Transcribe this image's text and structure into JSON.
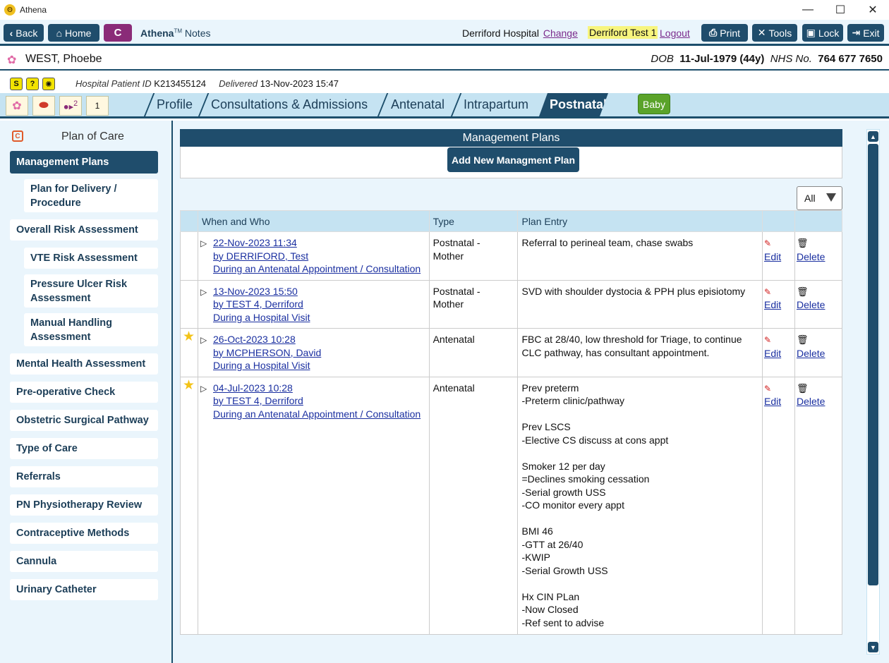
{
  "window": {
    "title": "Athena",
    "minimize": "—",
    "maximize": "☐",
    "close": "✕"
  },
  "toolbar": {
    "back_label": "Back",
    "home_label": "Home",
    "c_label": "C",
    "brand_name": "Athena",
    "brand_tm": "TM",
    "brand_suffix": " Notes",
    "hospital": "Derriford Hospital",
    "change_label": "Change",
    "user": "Derriford Test 1",
    "logout_label": "Logout",
    "print_label": "Print",
    "tools_label": "Tools",
    "lock_label": "Lock",
    "exit_label": "Exit"
  },
  "patient": {
    "name": "WEST, Phoebe",
    "dob_label": "DOB",
    "dob": "11-Jul-1979 (44y)",
    "nhs_label": "NHS No.",
    "nhs": "764 677 7650",
    "hospital_id_label": "Hospital Patient ID",
    "hospital_id": "K213455124",
    "delivered_label": "Delivered",
    "delivered": "13-Nov-2023 15:47"
  },
  "tab_icons": {
    "counter": "2",
    "note": "1"
  },
  "tabs": [
    "Profile",
    "Consultations & Admissions",
    "Antenatal",
    "Intrapartum",
    "Postnatal"
  ],
  "baby_label": "Baby",
  "sidebar": {
    "title": "Plan of Care",
    "items": [
      "Management Plans",
      "Plan for Delivery / Procedure",
      "Overall Risk Assessment",
      "VTE Risk Assessment",
      "Pressure Ulcer Risk Assessment",
      "Manual Handling Assessment",
      "Mental Health Assessment",
      "Pre-operative Check",
      "Obstetric Surgical Pathway",
      "Type of Care",
      "Referrals",
      "PN Physiotherapy Review",
      "Contraceptive Methods",
      "Cannula",
      "Urinary Catheter"
    ]
  },
  "panel": {
    "title": "Management Plans",
    "add_label": "Add New Managment Plan",
    "filter_value": "All"
  },
  "grid": {
    "headers": [
      "When and Who",
      "Type",
      "Plan Entry"
    ],
    "edit_label": "Edit",
    "delete_label": "Delete",
    "rows": [
      {
        "starred": false,
        "date": "22-Nov-2023 11:34",
        "by": "by DERRIFORD, Test",
        "context": "During an Antenatal Appointment / Consultation",
        "type": "Postnatal - Mother",
        "entry": "Referral to perineal team, chase swabs"
      },
      {
        "starred": false,
        "date": "13-Nov-2023 15:50",
        "by": "by TEST 4, Derriford",
        "context": "During a Hospital Visit",
        "type": "Postnatal - Mother",
        "entry": "SVD with shoulder dystocia & PPH plus episiotomy"
      },
      {
        "starred": true,
        "date": "26-Oct-2023 10:28",
        "by": "by MCPHERSON, David",
        "context": "During a Hospital Visit",
        "type": "Antenatal",
        "entry": "FBC at 28/40, low threshold for Triage, to continue CLC pathway, has consultant appointment."
      },
      {
        "starred": true,
        "date": "04-Jul-2023 10:28",
        "by": "by TEST 4, Derriford",
        "context": "During an Antenatal Appointment / Consultation",
        "type": "Antenatal",
        "entry": "Prev preterm\n-Preterm clinic/pathway\n\nPrev LSCS\n-Elective CS discuss at cons appt\n\nSmoker 12 per day\n=Declines smoking cessation\n-Serial growth USS\n-CO monitor every appt\n\nBMI 46\n-GTT at 26/40\n-KWIP\n-Serial Growth USS\n\nHx CIN PLan\n-Now Closed\n-Ref sent to advise"
      }
    ]
  },
  "colors": {
    "navy": "#1f4d6c",
    "light_blue": "#c5e3f2",
    "pale_blue": "#eaf5fc",
    "purple": "#8a2b78",
    "baby_green": "#5aa32a",
    "star": "#f3c318"
  },
  "icons": [
    "app-logo-icon",
    "back-chevron-icon",
    "home-icon",
    "printer-icon",
    "tools-icon",
    "lock-icon",
    "exit-icon",
    "flower-icon",
    "expand-triangle-icon",
    "star-icon",
    "pencil-icon",
    "trash-icon",
    "dropdown-arrow-icon"
  ]
}
